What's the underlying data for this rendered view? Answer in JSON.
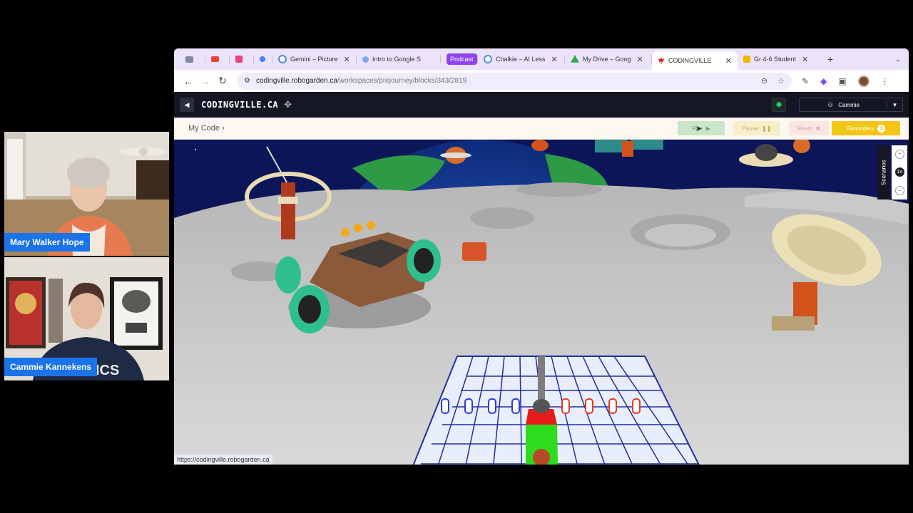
{
  "participants": [
    {
      "name": "Mary Walker Hope"
    },
    {
      "name": "Cammie Kannekens"
    }
  ],
  "shirt_text": "ICS",
  "browser": {
    "tabs": [
      {
        "label": "",
        "icon": "grid-icon",
        "color": "#7c8aa8"
      },
      {
        "label": "",
        "icon": "gmail-icon",
        "color": "#ea4335"
      },
      {
        "label": "",
        "icon": "app-icon",
        "color": "#e8457a"
      },
      {
        "label": "",
        "icon": "dot-icon",
        "color": "#4285f4"
      },
      {
        "label": "Gemini – Picture",
        "icon": "gemini-icon",
        "color": "#4285f4"
      },
      {
        "label": "Intro to Google S",
        "icon": "spark-icon",
        "color": "#7baaf7"
      },
      {
        "label": "Podcast",
        "icon": "podcast-pill",
        "color": "#8e44ef"
      },
      {
        "label": "Chalkie – AI Less",
        "icon": "chalkie-icon",
        "color": "#4a90d9"
      },
      {
        "label": "My Drive – Goog",
        "icon": "drive-icon",
        "color": "#34a853"
      },
      {
        "label": "CODINGVILLE",
        "icon": "maple-leaf-icon",
        "color": "#d62828",
        "active": true
      },
      {
        "label": "Gr 4-6 Student",
        "icon": "slides-icon",
        "color": "#f4b400"
      }
    ],
    "url": {
      "host": "codingville.robogarden.ca",
      "path": "/workspaces/prejourney/blocks/343/2819"
    },
    "status_url": "https://codingville.robogarden.ca"
  },
  "site": {
    "logo": "CODINGVILLE.CA",
    "user": "Cammie",
    "breadcrumb": "My Code",
    "run_label": "Run",
    "pause_label": "Pause",
    "reset_label": "Reset",
    "reminders_label": "Reminders",
    "reminders_count": "1",
    "scenarios_label": "Scenarios",
    "zoom_level": "1x"
  },
  "colors": {
    "accent_green": "#21d16b",
    "reminder_yellow": "#f3c614",
    "path_green": "#2edc1e",
    "target_red": "#e81b1b"
  }
}
